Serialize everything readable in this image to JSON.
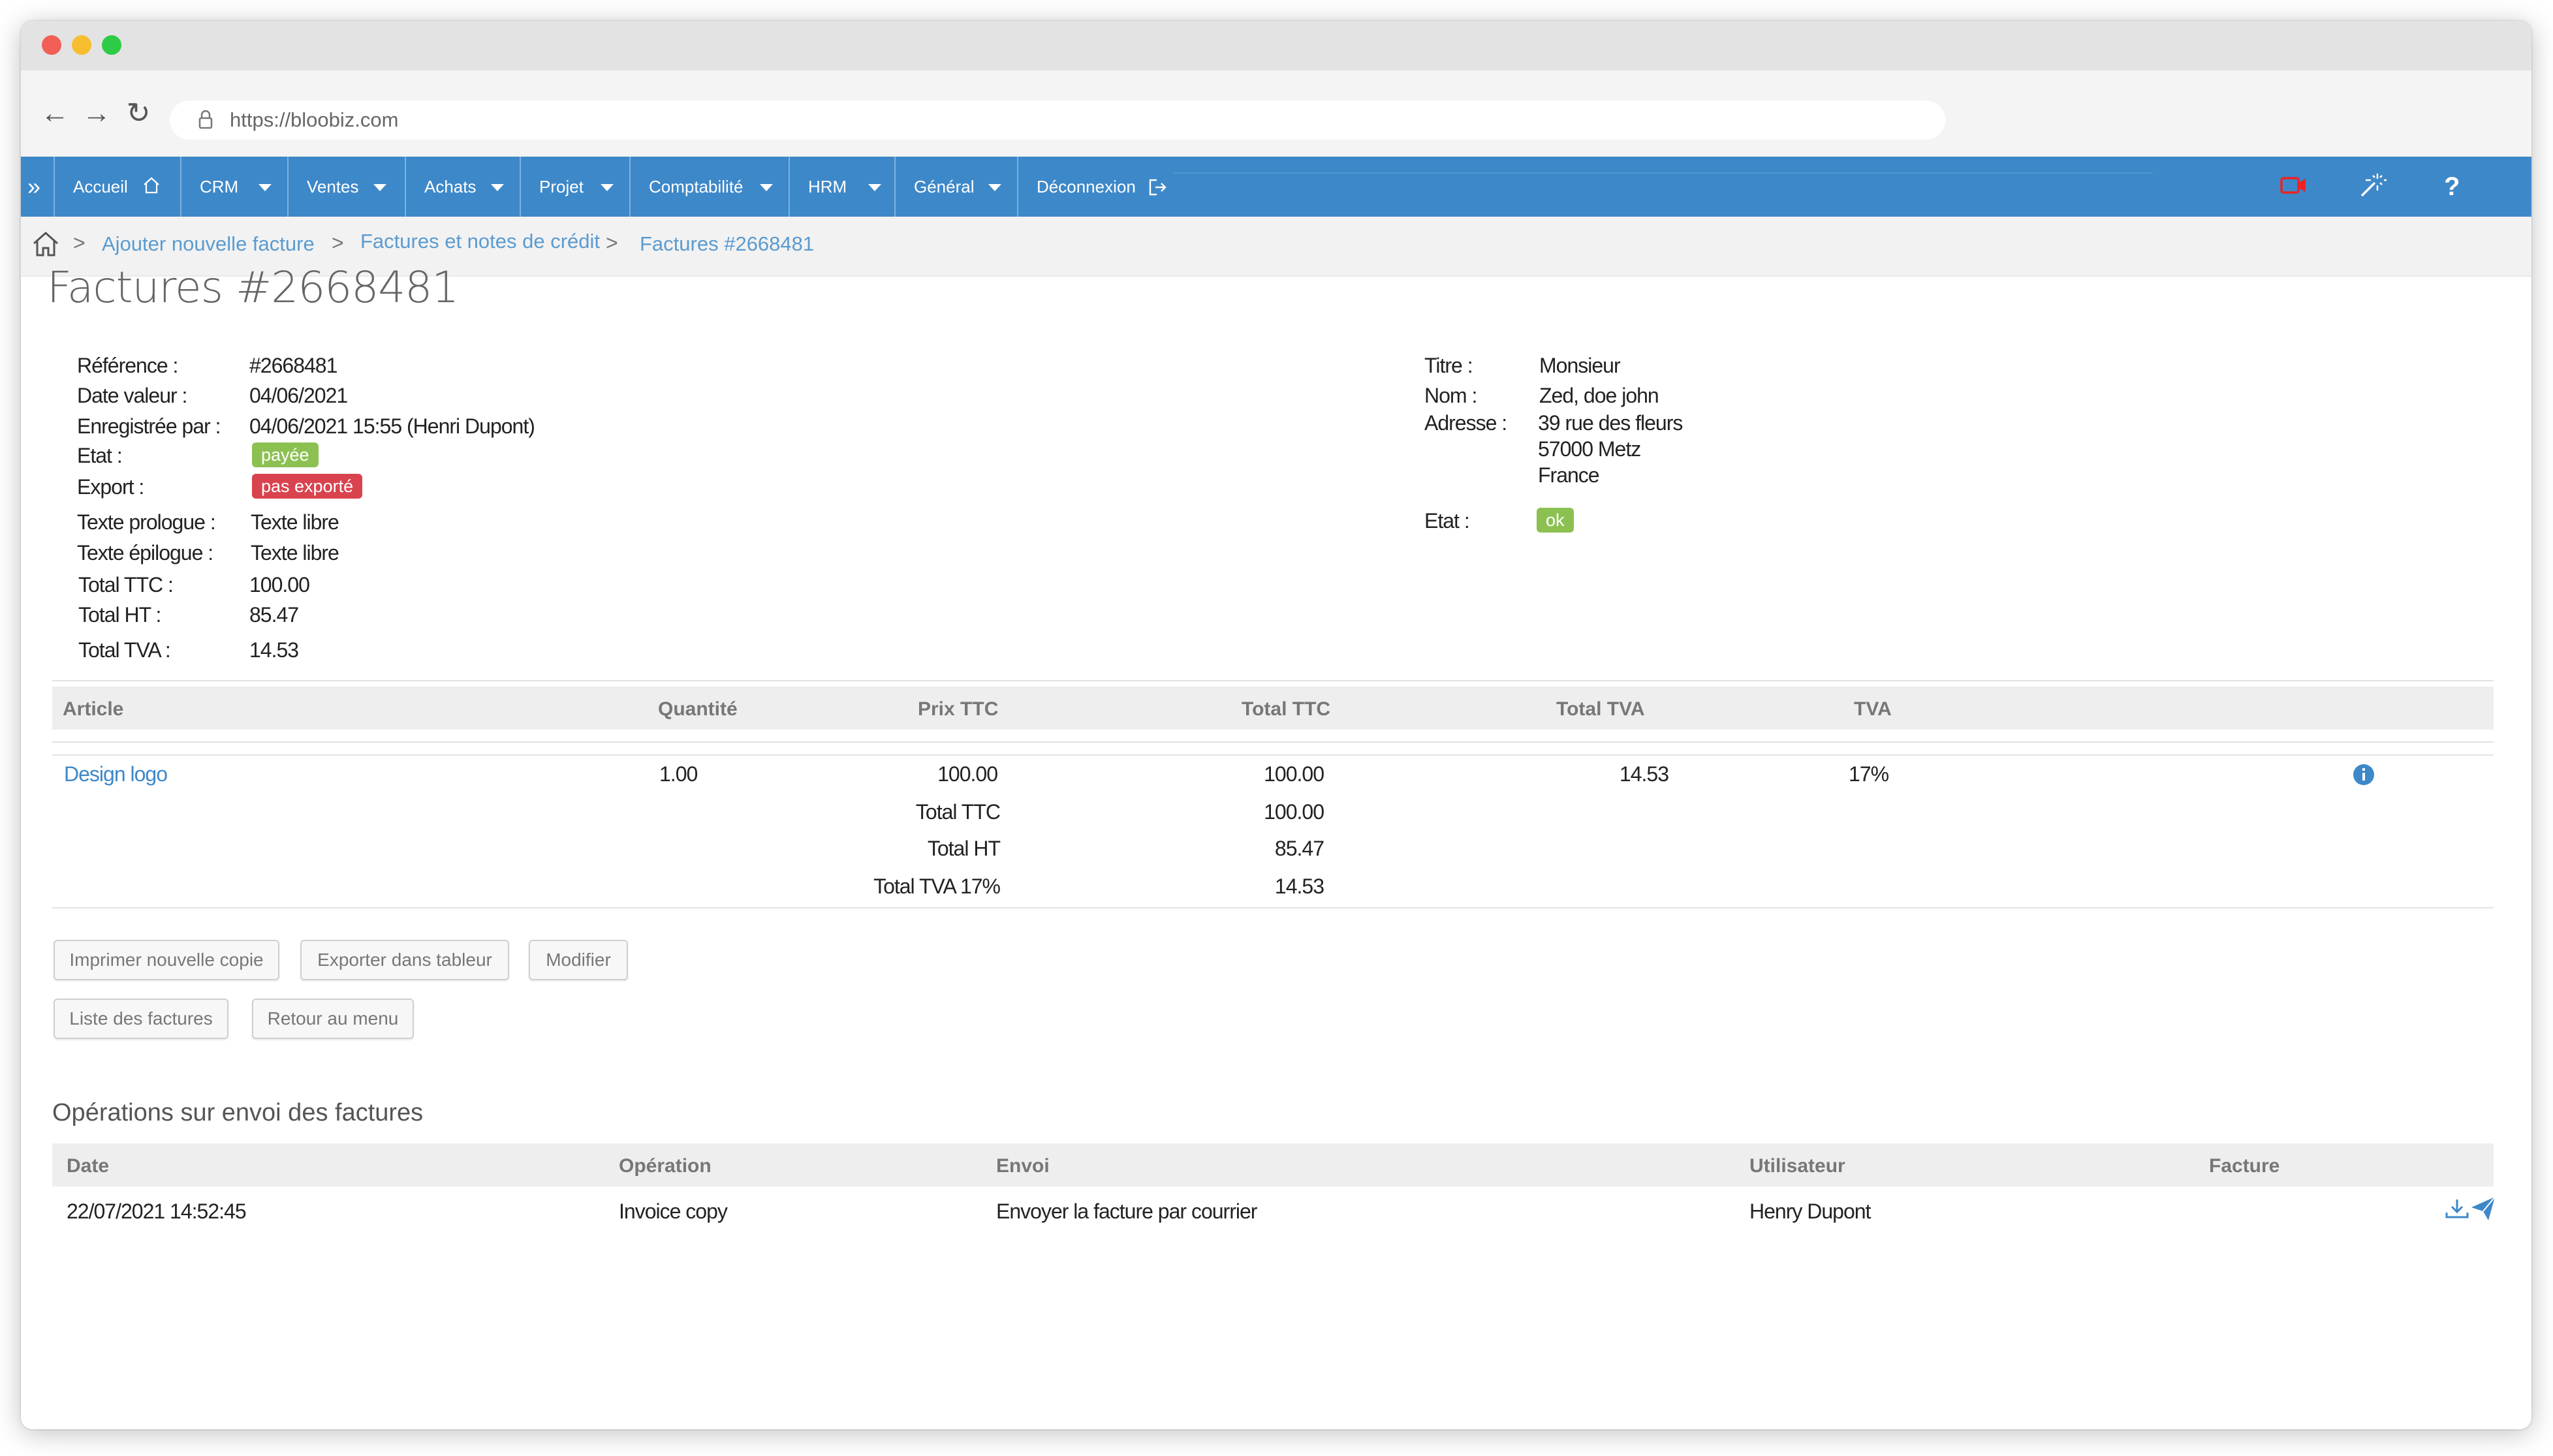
{
  "browser": {
    "url": "https://bloobiz.com"
  },
  "menu": {
    "items": [
      {
        "label": "Accueil"
      },
      {
        "label": "CRM"
      },
      {
        "label": "Ventes"
      },
      {
        "label": "Achats"
      },
      {
        "label": "Projet"
      },
      {
        "label": "Comptabilité"
      },
      {
        "label": "HRM"
      },
      {
        "label": "Général"
      },
      {
        "label": "Déconnexion"
      }
    ],
    "expand": "»",
    "help": "?"
  },
  "breadcrumb": [
    "Ajouter nouvelle facture",
    "Factures et notes de crédit",
    "Factures #2668481"
  ],
  "page_title": "Factures #2668481",
  "details": {
    "reference": {
      "label": "Référence :",
      "value": "#2668481"
    },
    "date_valeur": {
      "label": "Date valeur :",
      "value": "04/06/2021"
    },
    "enregistree": {
      "label": "Enregistrée par :",
      "value": "04/06/2021 15:55 (Henri Dupont)"
    },
    "etat": {
      "label": "Etat :",
      "value": "payée"
    },
    "export": {
      "label": "Export :",
      "value": "pas exporté"
    },
    "prologue": {
      "label": "Texte prologue :",
      "value": "Texte libre"
    },
    "epilogue": {
      "label": "Texte épilogue :",
      "value": "Texte libre"
    },
    "total_ttc": {
      "label": "Total TTC :",
      "value": "100.00"
    },
    "total_ht": {
      "label": "Total HT :",
      "value": "85.47"
    },
    "total_tva": {
      "label": "Total TVA :",
      "value": "14.53"
    }
  },
  "client": {
    "titre": {
      "label": "Titre :",
      "value": "Monsieur"
    },
    "nom": {
      "label": "Nom :",
      "value": "Zed, doe john"
    },
    "adresse": {
      "label": "Adresse :",
      "line1": "39 rue des fleurs",
      "line2": "57000 Metz",
      "line3": "France"
    },
    "etat": {
      "label": "Etat :",
      "value": "ok"
    }
  },
  "articles": {
    "headers": [
      "Article",
      "Quantité",
      "Prix TTC",
      "Total TTC",
      "Total TVA",
      "TVA"
    ],
    "row": {
      "article": "Design logo",
      "quantite": "1.00",
      "prix_ttc": "100.00",
      "total_ttc": "100.00",
      "total_tva": "14.53",
      "tva": "17%"
    },
    "totals": [
      {
        "label": "Total TTC",
        "value": "100.00"
      },
      {
        "label": "Total HT",
        "value": "85.47"
      },
      {
        "label": "Total TVA 17%",
        "value": "14.53"
      }
    ]
  },
  "buttons": {
    "print": "Imprimer nouvelle copie",
    "export": "Exporter dans tableur",
    "modify": "Modifier",
    "list": "Liste des factures",
    "back": "Retour au menu"
  },
  "operations": {
    "title": "Opérations sur envoi des factures",
    "headers": [
      "Date",
      "Opération",
      "Envoi",
      "Utilisateur",
      "Facture"
    ],
    "row": {
      "date": "22/07/2021 14:52:45",
      "operation": "Invoice copy",
      "envoi": "Envoyer la facture par courrier",
      "utilisateur": "Henry Dupont"
    }
  },
  "colors": {
    "menu": "#3d88c9",
    "paid": "#8cc152",
    "not_exported": "#d9434e",
    "ok": "#8cc152",
    "link": "#3d88c9"
  }
}
